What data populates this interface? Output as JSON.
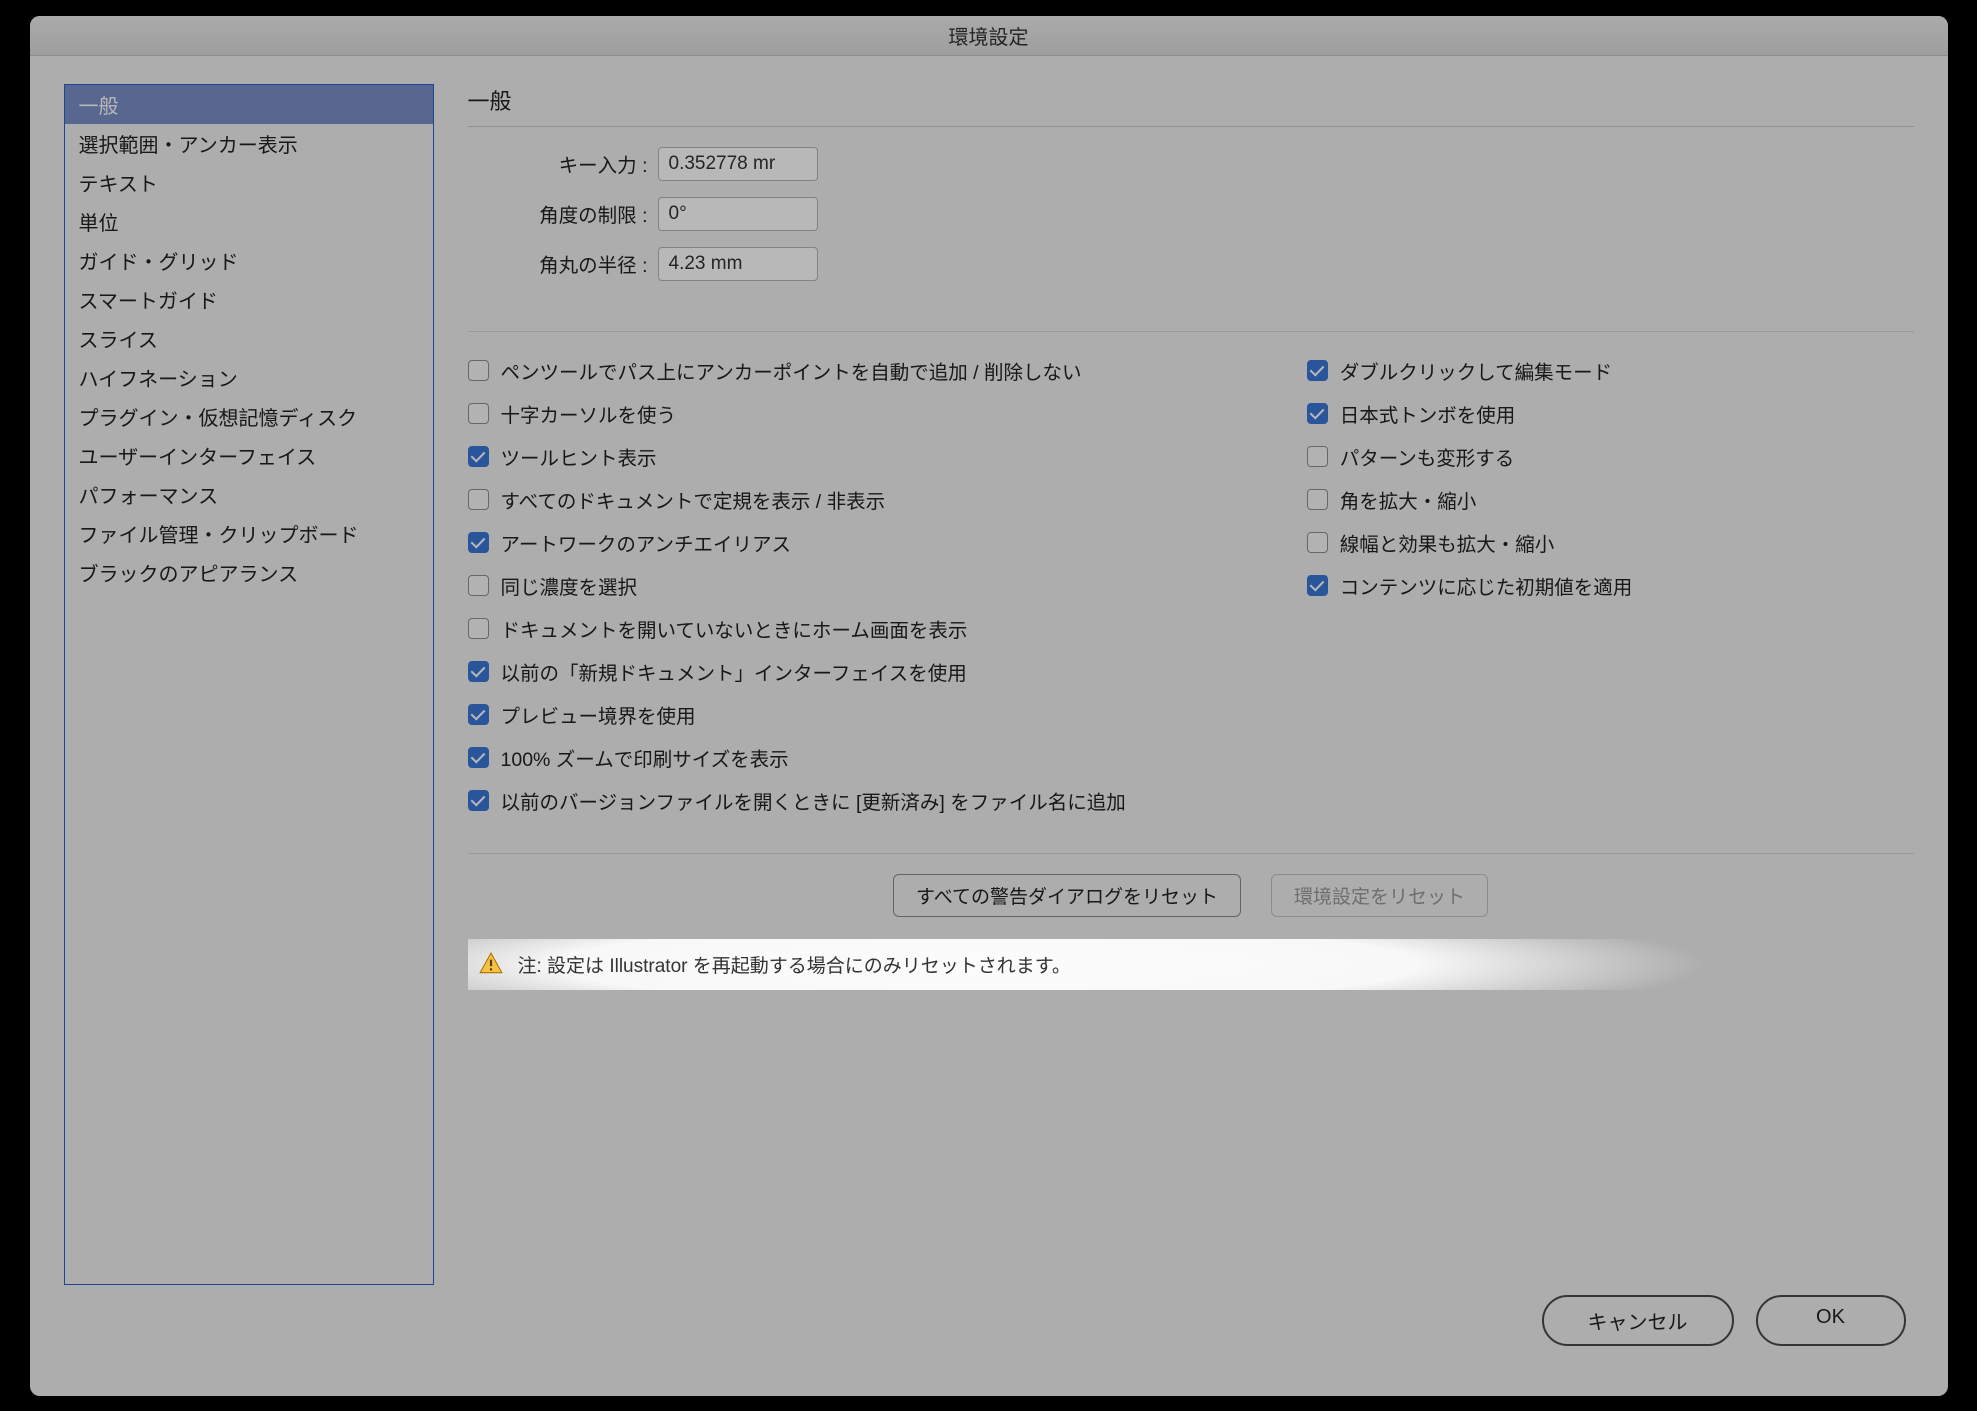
{
  "title": "環境設定",
  "sidebar": {
    "items": [
      {
        "label": "一般",
        "selected": true
      },
      {
        "label": "選択範囲・アンカー表示",
        "selected": false
      },
      {
        "label": "テキスト",
        "selected": false
      },
      {
        "label": "単位",
        "selected": false
      },
      {
        "label": "ガイド・グリッド",
        "selected": false
      },
      {
        "label": "スマートガイド",
        "selected": false
      },
      {
        "label": "スライス",
        "selected": false
      },
      {
        "label": "ハイフネーション",
        "selected": false
      },
      {
        "label": "プラグイン・仮想記憶ディスク",
        "selected": false
      },
      {
        "label": "ユーザーインターフェイス",
        "selected": false
      },
      {
        "label": "パフォーマンス",
        "selected": false
      },
      {
        "label": "ファイル管理・クリップボード",
        "selected": false
      },
      {
        "label": "ブラックのアピアランス",
        "selected": false
      }
    ]
  },
  "main": {
    "heading": "一般",
    "fields": {
      "key_input_label": "キー入力 :",
      "key_input_value": "0.352778 mr",
      "angle_label": "角度の制限 :",
      "angle_value": "0°",
      "radius_label": "角丸の半径 :",
      "radius_value": "4.23 mm"
    },
    "checks_left": [
      {
        "label": "ペンツールでパス上にアンカーポイントを自動で追加 / 削除しない",
        "checked": false
      },
      {
        "label": "十字カーソルを使う",
        "checked": false
      },
      {
        "label": "ツールヒント表示",
        "checked": true
      },
      {
        "label": "すべてのドキュメントで定規を表示 / 非表示",
        "checked": false
      },
      {
        "label": "アートワークのアンチエイリアス",
        "checked": true
      },
      {
        "label": "同じ濃度を選択",
        "checked": false
      },
      {
        "label": "ドキュメントを開いていないときにホーム画面を表示",
        "checked": false
      },
      {
        "label": "以前の「新規ドキュメント」インターフェイスを使用",
        "checked": true
      },
      {
        "label": "プレビュー境界を使用",
        "checked": true
      },
      {
        "label": "100% ズームで印刷サイズを表示",
        "checked": true
      },
      {
        "label": "以前のバージョンファイルを開くときに [更新済み] をファイル名に追加",
        "checked": true
      }
    ],
    "checks_right": [
      {
        "label": "ダブルクリックして編集モード",
        "checked": true
      },
      {
        "label": "日本式トンボを使用",
        "checked": true
      },
      {
        "label": "パターンも変形する",
        "checked": false
      },
      {
        "label": "角を拡大・縮小",
        "checked": false
      },
      {
        "label": "線幅と効果も拡大・縮小",
        "checked": false
      },
      {
        "label": "コンテンツに応じた初期値を適用",
        "checked": true
      }
    ],
    "reset_warnings": "すべての警告ダイアログをリセット",
    "reset_prefs": "環境設定をリセット",
    "note": "注: 設定は Illustrator を再起動する場合にのみリセットされます。"
  },
  "footer": {
    "cancel": "キャンセル",
    "ok": "OK"
  }
}
